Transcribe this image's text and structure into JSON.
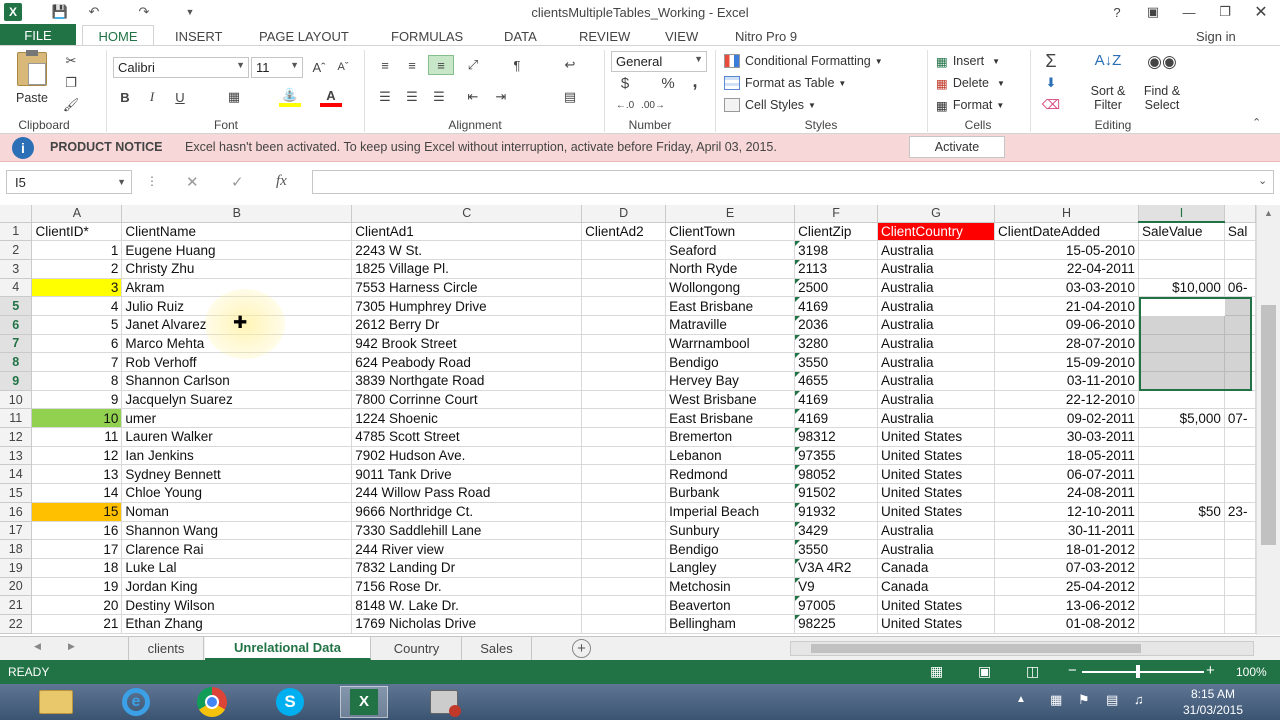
{
  "window": {
    "title": "clientsMultipleTables_Working - Excel",
    "help": "?"
  },
  "ribbon_tabs": [
    "FILE",
    "HOME",
    "INSERT",
    "PAGE LAYOUT",
    "FORMULAS",
    "DATA",
    "REVIEW",
    "VIEW",
    "Nitro Pro 9"
  ],
  "signin": "Sign in",
  "ribbon": {
    "clipboard": {
      "paste": "Paste",
      "label": "Clipboard"
    },
    "font": {
      "name": "Calibri",
      "size": "11",
      "label": "Font",
      "bold": "B",
      "italic": "I",
      "underline": "U"
    },
    "alignment": {
      "label": "Alignment"
    },
    "number": {
      "format": "General",
      "label": "Number",
      "currency": "$",
      "percent": "%",
      "comma": ","
    },
    "styles": {
      "conditional": "Conditional Formatting",
      "table": "Format as Table",
      "cell": "Cell Styles",
      "label": "Styles"
    },
    "cells": {
      "insert": "Insert",
      "delete": "Delete",
      "format": "Format",
      "label": "Cells"
    },
    "editing": {
      "sort": "Sort &",
      "filter": "Filter",
      "find": "Find &",
      "select": "Select",
      "label": "Editing"
    }
  },
  "notice": {
    "title": "PRODUCT NOTICE",
    "text": "Excel hasn't been activated. To keep using Excel without interruption, activate before Friday, April 03, 2015.",
    "button": "Activate"
  },
  "formula_bar": {
    "name_box": "I5",
    "value": ""
  },
  "columns": [
    "A",
    "B",
    "C",
    "D",
    "E",
    "F",
    "G",
    "H",
    "I",
    ""
  ],
  "rows": [
    [
      "ClientID*",
      "ClientName",
      "ClientAd1",
      "ClientAd2",
      "ClientTown",
      "ClientZip",
      "ClientCountry",
      "ClientDateAdded",
      "SaleValue",
      "Sal"
    ],
    [
      "1",
      "Eugene Huang",
      "2243 W St.",
      "",
      "Seaford",
      "3198",
      "Australia",
      "15-05-2010",
      "",
      ""
    ],
    [
      "2",
      "Christy Zhu",
      "1825 Village Pl.",
      "",
      "North Ryde",
      "2113",
      "Australia",
      "22-04-2011",
      "",
      ""
    ],
    [
      "3",
      "Akram",
      "7553 Harness Circle",
      "",
      "Wollongong",
      "2500",
      "Australia",
      "03-03-2010",
      "$10,000",
      "06-"
    ],
    [
      "4",
      "Julio Ruiz",
      "7305 Humphrey Drive",
      "",
      "East Brisbane",
      "4169",
      "Australia",
      "21-04-2010",
      "",
      ""
    ],
    [
      "5",
      "Janet Alvarez",
      "2612 Berry Dr",
      "",
      "Matraville",
      "2036",
      "Australia",
      "09-06-2010",
      "",
      ""
    ],
    [
      "6",
      "Marco Mehta",
      "942 Brook Street",
      "",
      "Warrnambool",
      "3280",
      "Australia",
      "28-07-2010",
      "",
      ""
    ],
    [
      "7",
      "Rob Verhoff",
      "624 Peabody Road",
      "",
      "Bendigo",
      "3550",
      "Australia",
      "15-09-2010",
      "",
      ""
    ],
    [
      "8",
      "Shannon Carlson",
      "3839 Northgate Road",
      "",
      "Hervey Bay",
      "4655",
      "Australia",
      "03-11-2010",
      "",
      ""
    ],
    [
      "9",
      "Jacquelyn Suarez",
      "7800 Corrinne Court",
      "",
      "West Brisbane",
      "4169",
      "Australia",
      "22-12-2010",
      "",
      ""
    ],
    [
      "10",
      "umer",
      "1224 Shoenic",
      "",
      "East Brisbane",
      "4169",
      "Australia",
      "09-02-2011",
      "$5,000",
      "07-"
    ],
    [
      "11",
      "Lauren Walker",
      "4785 Scott Street",
      "",
      "Bremerton",
      "98312",
      "United States",
      "30-03-2011",
      "",
      ""
    ],
    [
      "12",
      "Ian Jenkins",
      "7902 Hudson Ave.",
      "",
      "Lebanon",
      "97355",
      "United States",
      "18-05-2011",
      "",
      ""
    ],
    [
      "13",
      "Sydney Bennett",
      "9011 Tank Drive",
      "",
      "Redmond",
      "98052",
      "United States",
      "06-07-2011",
      "",
      ""
    ],
    [
      "14",
      "Chloe Young",
      "244 Willow Pass Road",
      "",
      "Burbank",
      "91502",
      "United States",
      "24-08-2011",
      "",
      ""
    ],
    [
      "15",
      "Noman",
      "9666 Northridge Ct.",
      "",
      "Imperial Beach",
      "91932",
      "United States",
      "12-10-2011",
      "$50",
      "23-"
    ],
    [
      "16",
      "Shannon Wang",
      "7330 Saddlehill Lane",
      "",
      "Sunbury",
      "3429",
      "Australia",
      "30-11-2011",
      "",
      ""
    ],
    [
      "17",
      "Clarence Rai",
      "244 River view",
      "",
      "Bendigo",
      "3550",
      "Australia",
      "18-01-2012",
      "",
      ""
    ],
    [
      "18",
      "Luke Lal",
      "7832 Landing Dr",
      "",
      "Langley",
      "V3A 4R2",
      "Canada",
      "07-03-2012",
      "",
      ""
    ],
    [
      "19",
      "Jordan King",
      "7156 Rose Dr.",
      "",
      "Metchosin",
      "V9",
      "Canada",
      "25-04-2012",
      "",
      ""
    ],
    [
      "20",
      "Destiny Wilson",
      "8148 W. Lake Dr.",
      "",
      "Beaverton",
      "97005",
      "United States",
      "13-06-2012",
      "",
      ""
    ],
    [
      "21",
      "Ethan Zhang",
      "1769 Nicholas Drive",
      "",
      "Bellingham",
      "98225",
      "United States",
      "01-08-2012",
      "",
      ""
    ]
  ],
  "sheets": [
    "clients",
    "Unrelational Data",
    "Country",
    "Sales"
  ],
  "active_sheet": "Unrelational Data",
  "status": {
    "ready": "READY",
    "zoom": "100%"
  },
  "clock": {
    "time": "8:15 AM",
    "date": "31/03/2015"
  },
  "colors": {
    "accent": "#217346",
    "yellow": "#ffff00",
    "green": "#92d050",
    "orange": "#ffc000",
    "red": "#ff0000"
  }
}
